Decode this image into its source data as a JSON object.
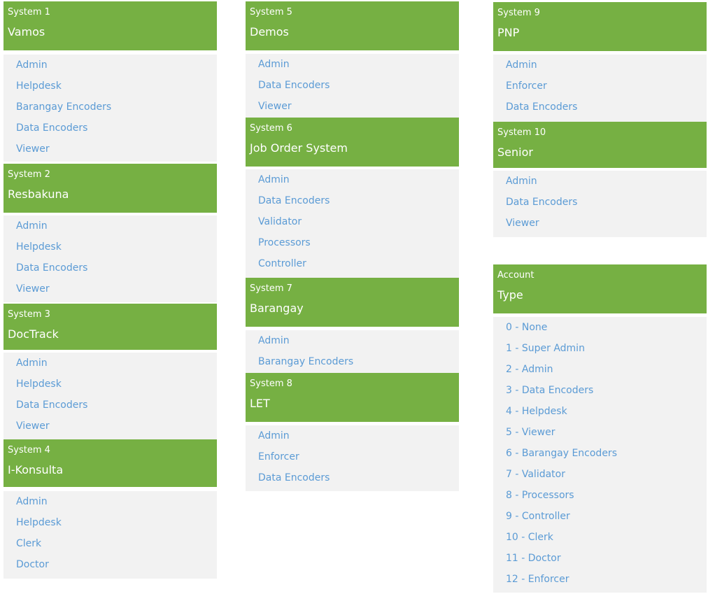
{
  "columns": [
    {
      "panels": [
        {
          "id": "system-1",
          "sub": "System 1",
          "title": "Vamos",
          "items": [
            "Admin",
            "Helpdesk",
            "Barangay Encoders",
            "Data Encoders",
            "Viewer"
          ]
        },
        {
          "id": "system-2",
          "sub": "System 2",
          "title": "Resbakuna",
          "items": [
            "Admin",
            "Helpdesk",
            "Data Encoders",
            "Viewer"
          ]
        },
        {
          "id": "system-3",
          "sub": "System 3",
          "title": "DocTrack",
          "items": [
            "Admin",
            "Helpdesk",
            "Data Encoders",
            "Viewer"
          ]
        },
        {
          "id": "system-4",
          "sub": "System 4",
          "title": "I-Konsulta",
          "items": [
            "Admin",
            "Helpdesk",
            "Clerk",
            "Doctor"
          ]
        }
      ]
    },
    {
      "panels": [
        {
          "id": "system-5",
          "sub": "System 5",
          "title": "Demos",
          "items": [
            "Admin",
            "Data Encoders",
            "Viewer"
          ]
        },
        {
          "id": "system-6",
          "sub": "System 6",
          "title": "Job Order System",
          "items": [
            "Admin",
            "Data Encoders",
            "Validator",
            "Processors",
            "Controller"
          ]
        },
        {
          "id": "system-7",
          "sub": "System 7",
          "title": "Barangay",
          "items": [
            "Admin",
            "Barangay Encoders"
          ]
        },
        {
          "id": "system-8",
          "sub": "System 8",
          "title": "LET",
          "items": [
            "Admin",
            "Enforcer",
            "Data Encoders"
          ]
        }
      ]
    },
    {
      "panels": [
        {
          "id": "system-9",
          "sub": "System 9",
          "title": "PNP",
          "items": [
            "Admin",
            "Enforcer",
            "Data Encoders"
          ]
        },
        {
          "id": "system-10",
          "sub": "System 10",
          "title": "Senior",
          "items": [
            "Admin",
            "Data Encoders",
            "Viewer"
          ]
        },
        {
          "id": "account-type",
          "sub": "Account",
          "title": "Type",
          "items": [
            "0 - None",
            "1 - Super Admin",
            "2 - Admin",
            "3 - Data Encoders",
            "4 - Helpdesk",
            "5 - Viewer",
            "6 - Barangay Encoders",
            "7 - Validator",
            "8 - Processors",
            "9 - Controller",
            "10 - Clerk",
            "11 - Doctor",
            "12 - Enforcer"
          ]
        }
      ]
    }
  ],
  "colors": {
    "header_bg": "#76b043",
    "header_text": "#ffffff",
    "list_bg": "#f2f2f2",
    "link_text": "#5b9bd5"
  }
}
